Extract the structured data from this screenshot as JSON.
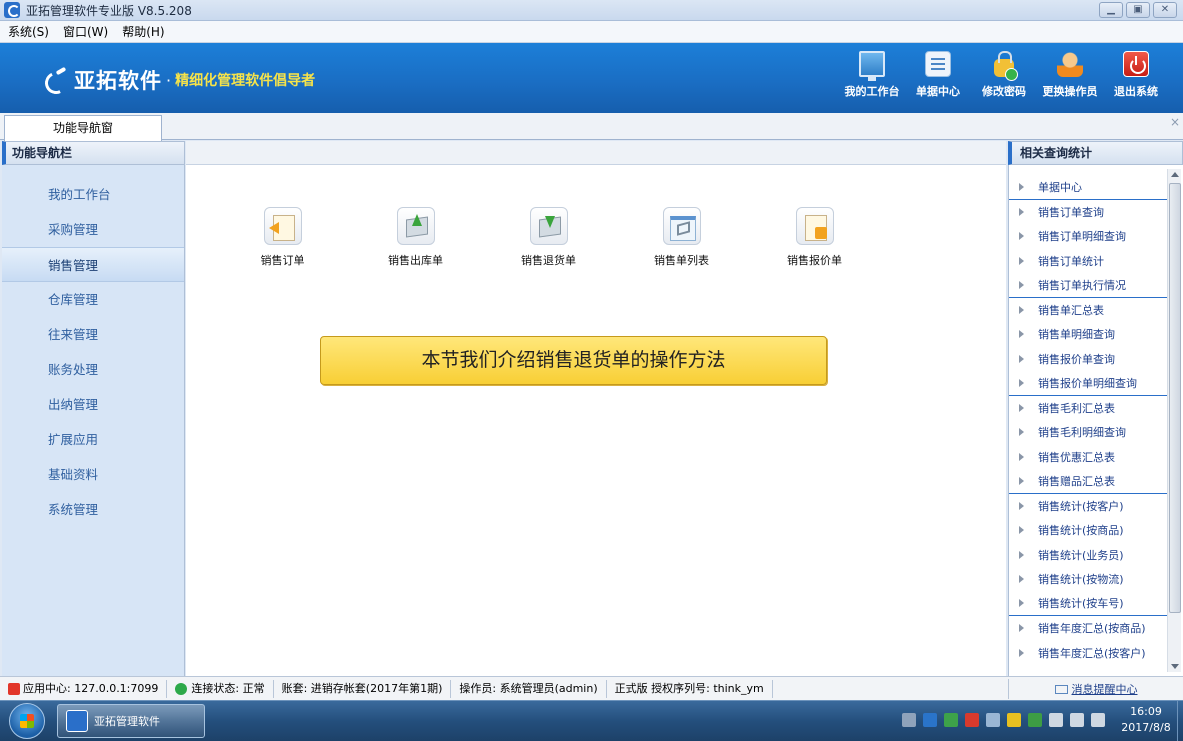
{
  "window": {
    "title": "亚拓管理软件专业版 V8.5.208",
    "controls": [
      "▁",
      "▣",
      "✕"
    ]
  },
  "menu": [
    "系统(S)",
    "窗口(W)",
    "帮助(H)"
  ],
  "banner": {
    "brand": "亚拓软件",
    "separator": "·",
    "slogan": "精细化管理软件倡导者",
    "tools": [
      {
        "label": "我的工作台",
        "icon": "monitor-icon"
      },
      {
        "label": "单据中心",
        "icon": "document-list-icon"
      },
      {
        "label": "修改密码",
        "icon": "lock-icon"
      },
      {
        "label": "更换操作员",
        "icon": "user-icon"
      },
      {
        "label": "退出系统",
        "icon": "power-icon"
      }
    ]
  },
  "tab": {
    "label": "功能导航窗",
    "close": "×"
  },
  "left": {
    "header": "功能导航栏",
    "items": [
      "我的工作台",
      "采购管理",
      "销售管理",
      "仓库管理",
      "往来管理",
      "账务处理",
      "出纳管理",
      "扩展应用",
      "基础资料",
      "系统管理"
    ],
    "active_index": 2
  },
  "main": {
    "functions": [
      {
        "label": "销售订单",
        "icon": "sales-order-icon"
      },
      {
        "label": "销售出库单",
        "icon": "outbound-box-icon"
      },
      {
        "label": "销售退货单",
        "icon": "return-box-icon"
      },
      {
        "label": "销售单列表",
        "icon": "list-window-icon"
      },
      {
        "label": "销售报价单",
        "icon": "quotation-icon"
      }
    ],
    "callout": "本节我们介绍销售退货单的操作方法"
  },
  "right": {
    "header": "相关查询统计",
    "items": [
      {
        "label": "单据中心",
        "sep": true
      },
      {
        "label": "销售订单查询",
        "sep": false
      },
      {
        "label": "销售订单明细查询",
        "sep": false
      },
      {
        "label": "销售订单统计",
        "sep": false
      },
      {
        "label": "销售订单执行情况",
        "sep": true
      },
      {
        "label": "销售单汇总表",
        "sep": false
      },
      {
        "label": "销售单明细查询",
        "sep": false
      },
      {
        "label": "销售报价单查询",
        "sep": false
      },
      {
        "label": "销售报价单明细查询",
        "sep": true
      },
      {
        "label": "销售毛利汇总表",
        "sep": false
      },
      {
        "label": "销售毛利明细查询",
        "sep": false
      },
      {
        "label": "销售优惠汇总表",
        "sep": false
      },
      {
        "label": "销售赠品汇总表",
        "sep": true
      },
      {
        "label": "销售统计(按客户)",
        "sep": false
      },
      {
        "label": "销售统计(按商品)",
        "sep": false
      },
      {
        "label": "销售统计(业务员)",
        "sep": false
      },
      {
        "label": "销售统计(按物流)",
        "sep": false
      },
      {
        "label": "销售统计(按车号)",
        "sep": true
      },
      {
        "label": "销售年度汇总(按商品)",
        "sep": false
      },
      {
        "label": "销售年度汇总(按客户)",
        "sep": false
      }
    ]
  },
  "status": {
    "app_center": "应用中心: 127.0.0.1:7099",
    "connection": "连接状态: 正常",
    "account": "账套: 进销存帐套(2017年第1期)",
    "operator": "操作员: 系统管理员(admin)",
    "license": "正式版 授权序列号: think_ym",
    "message_center": "消息提醒中心"
  },
  "taskbar": {
    "app": "亚拓管理软件",
    "time": "16:09",
    "date": "2017/8/8",
    "tray_colors": [
      "#8fa3bb",
      "#2a74c9",
      "#3da24a",
      "#d83a2d",
      "#9ab6d4",
      "#e8c020",
      "#3d9d44",
      "#cfd8e2",
      "#cfd8e2",
      "#cfd8e2"
    ]
  }
}
